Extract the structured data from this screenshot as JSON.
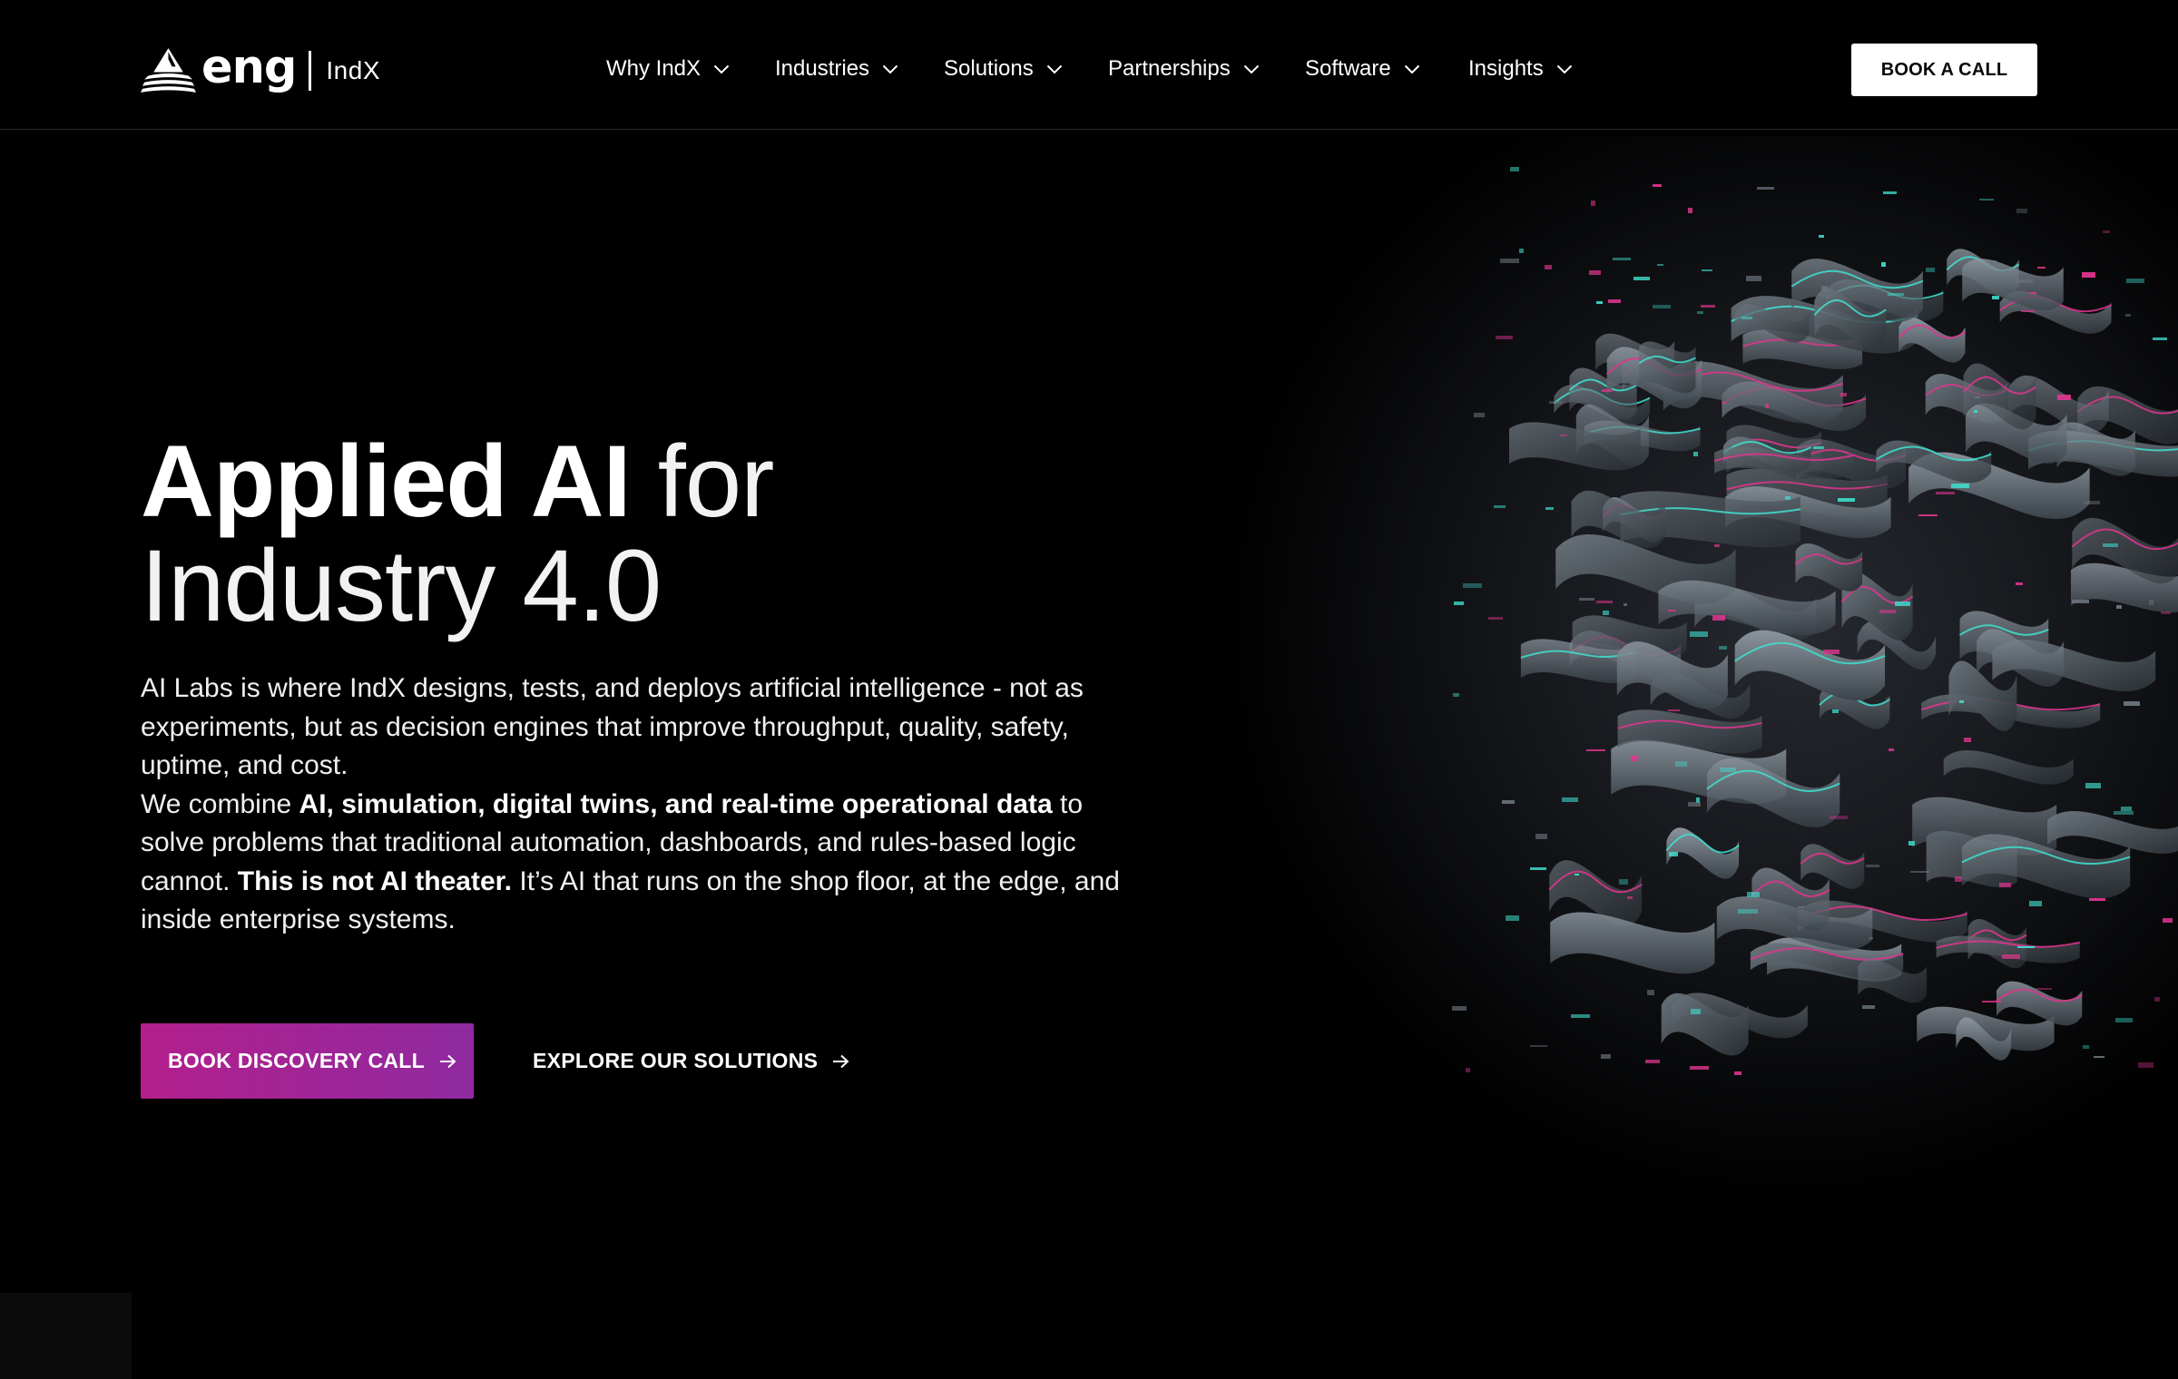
{
  "brand": {
    "wordmark": "eng",
    "product": "IndX",
    "icon": "eng-logo-mark"
  },
  "nav": {
    "items": [
      {
        "label": "Why IndX",
        "icon": "chevron-down-icon"
      },
      {
        "label": "Industries",
        "icon": "chevron-down-icon"
      },
      {
        "label": "Solutions",
        "icon": "chevron-down-icon"
      },
      {
        "label": "Partnerships",
        "icon": "chevron-down-icon"
      },
      {
        "label": "Software",
        "icon": "chevron-down-icon"
      },
      {
        "label": "Insights",
        "icon": "chevron-down-icon"
      }
    ],
    "cta_label": "BOOK A CALL"
  },
  "hero": {
    "title_bold": "Applied AI",
    "title_light": "for",
    "title_line2": "Industry 4.0",
    "paragraph1": "AI Labs is where IndX designs, tests, and deploys artificial intelligence - not as experiments, but as decision engines that improve throughput, quality, safety, uptime, and cost.",
    "p2_intro": "We combine ",
    "p2_bold": "AI, simulation, digital twins, and real-time operational data",
    "p2_mid": " to solve problems that traditional automation, dashboards, and rules-based logic cannot. ",
    "p2_bold2": "This is not AI theater.",
    "p2_end": " It’s AI that runs on the shop floor, at the edge, and inside enterprise systems.",
    "cta_primary": "BOOK DISCOVERY CALL",
    "cta_secondary": "EXPLORE OUR SOLUTIONS",
    "arrow_icon": "arrow-right-icon",
    "art": "abstract-data-ribbons-illustration"
  },
  "colors": {
    "background": "#000000",
    "accent_gradient_start": "#b21f8c",
    "accent_gradient_end": "#8f2aa0",
    "art_teal": "#3fe0d0",
    "art_magenta": "#e0358f",
    "art_slate": "#5d6770"
  }
}
